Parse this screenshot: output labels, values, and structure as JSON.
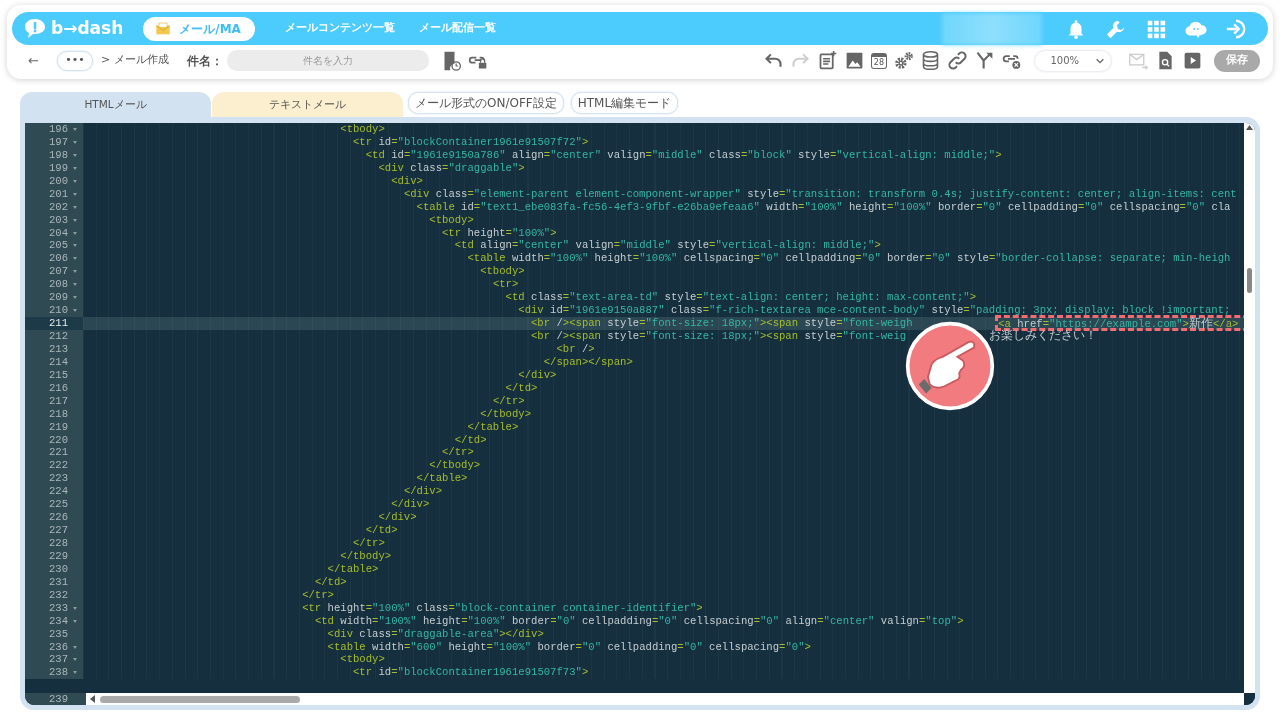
{
  "header": {
    "logo": "b→dash",
    "module": "メール/MA",
    "nav": [
      "メールコンテンツ一覧",
      "メール配信一覧"
    ],
    "icons": [
      {
        "kind": "bell"
      },
      {
        "kind": "wrench"
      },
      {
        "kind": "apps"
      },
      {
        "kind": "mascot"
      },
      {
        "kind": "signin"
      }
    ]
  },
  "toolbar": {
    "back": "←",
    "more": "•••",
    "breadcrumb": "> メール作成",
    "subject_label": "件名：",
    "subject": {
      "placeholder": "件名を入力"
    },
    "left_tools": [
      {
        "kind": "doc-clock",
        "disabled": false
      },
      {
        "kind": "link-lock",
        "disabled": false
      }
    ],
    "tools": [
      {
        "kind": "undo",
        "disabled": false
      },
      {
        "kind": "redo",
        "disabled": true
      },
      {
        "kind": "add-note",
        "disabled": false
      },
      {
        "kind": "image",
        "disabled": false
      },
      {
        "kind": "calendar",
        "text": "28",
        "disabled": false
      },
      {
        "kind": "gears",
        "disabled": false
      },
      {
        "kind": "database",
        "disabled": false
      },
      {
        "kind": "link",
        "disabled": false
      },
      {
        "kind": "merge",
        "disabled": false
      },
      {
        "kind": "unlink",
        "disabled": false
      }
    ],
    "zoom": "100%",
    "right_tools": [
      {
        "kind": "mail-send",
        "disabled": true
      },
      {
        "kind": "doc-search",
        "disabled": false
      },
      {
        "kind": "play",
        "disabled": false
      }
    ],
    "save": {
      "label": "保存",
      "disabled": true
    }
  },
  "tabs": [
    {
      "label": "HTMLメール",
      "selected": true
    },
    {
      "label": "テキストメール",
      "selected": false
    }
  ],
  "mode_buttons": [
    "メール形式のON/OFF設定",
    "HTML編集モード"
  ],
  "editor": {
    "lines": [
      {
        "number": "196",
        "foldable": true,
        "active": false,
        "segments": [
          "                                        <tbody>"
        ]
      },
      {
        "number": "197",
        "foldable": true,
        "active": false,
        "segments": [
          "                                          <tr id=\"blockContainer1961e91507f72\">"
        ]
      },
      {
        "number": "198",
        "foldable": true,
        "active": false,
        "segments": [
          "                                            <td id=\"1961e9150a786\" align=\"center\" valign=\"middle\" class=\"block\" style=\"vertical-align: middle;\">"
        ]
      },
      {
        "number": "199",
        "foldable": true,
        "active": false,
        "segments": [
          "                                              <div class=\"draggable\">"
        ]
      },
      {
        "number": "200",
        "foldable": true,
        "active": false,
        "segments": [
          "                                                <div>"
        ]
      },
      {
        "number": "201",
        "foldable": true,
        "active": false,
        "segments": [
          "                                                  <div class=\"element-parent element-component-wrapper\" style=\"transition: transform 0.4s; justify-content: center; align-items: cent"
        ]
      },
      {
        "number": "202",
        "foldable": true,
        "active": false,
        "segments": [
          "                                                    <table id=\"text1_ebe083fa-fc56-4ef3-9fbf-e26ba9efeaa6\" width=\"100%\" height=\"100%\" border=\"0\" cellpadding=\"0\" cellspacing=\"0\" cla"
        ]
      },
      {
        "number": "203",
        "foldable": true,
        "active": false,
        "segments": [
          "                                                      <tbody>"
        ]
      },
      {
        "number": "204",
        "foldable": true,
        "active": false,
        "segments": [
          "                                                        <tr height=\"100%\">"
        ]
      },
      {
        "number": "205",
        "foldable": true,
        "active": false,
        "segments": [
          "                                                          <td align=\"center\" valign=\"middle\" style=\"vertical-align: middle;\">"
        ]
      },
      {
        "number": "206",
        "foldable": true,
        "active": false,
        "segments": [
          "                                                            <table width=\"100%\" height=\"100%\" cellspacing=\"0\" cellpadding=\"0\" border=\"0\" style=\"border-collapse: separate; min-heigh"
        ]
      },
      {
        "number": "207",
        "foldable": true,
        "active": false,
        "segments": [
          "                                                              <tbody>"
        ]
      },
      {
        "number": "208",
        "foldable": true,
        "active": false,
        "segments": [
          "                                                                <tr>"
        ]
      },
      {
        "number": "209",
        "foldable": true,
        "active": false,
        "segments": [
          "                                                                  <td class=\"text-area-td\" style=\"text-align: center; height: max-content;\">"
        ]
      },
      {
        "number": "210",
        "foldable": true,
        "active": false,
        "segments": [
          "                                                                    <div id=\"1961e9150a887\" class=\"f-rich-textarea mce-content-body\" style=\"padding: 3px; display: block !important;"
        ]
      },
      {
        "number": "211",
        "foldable": false,
        "active": true,
        "callout": true,
        "segments": [
          "                                                                      <br /><span style=\"font-size: 18px;\"><span style=\"font-weigh",
          "<a href=\"https://example.com\">新作</a>"
        ]
      },
      {
        "number": "212",
        "foldable": false,
        "active": false,
        "segments": [
          "                                                                      <br /><span style=\"font-size: 18px;\"><span style=\"font-weig",
          "お楽しみください！"
        ]
      },
      {
        "number": "213",
        "foldable": false,
        "active": false,
        "segments": [
          "                                                                          <br />"
        ]
      },
      {
        "number": "214",
        "foldable": false,
        "active": false,
        "segments": [
          "                                                                        </span></span>"
        ]
      },
      {
        "number": "215",
        "foldable": false,
        "active": false,
        "segments": [
          "                                                                    </div>"
        ]
      },
      {
        "number": "216",
        "foldable": false,
        "active": false,
        "segments": [
          "                                                                  </td>"
        ]
      },
      {
        "number": "217",
        "foldable": false,
        "active": false,
        "segments": [
          "                                                                </tr>"
        ]
      },
      {
        "number": "218",
        "foldable": false,
        "active": false,
        "segments": [
          "                                                              </tbody>"
        ]
      },
      {
        "number": "219",
        "foldable": false,
        "active": false,
        "segments": [
          "                                                            </table>"
        ]
      },
      {
        "number": "220",
        "foldable": false,
        "active": false,
        "segments": [
          "                                                          </td>"
        ]
      },
      {
        "number": "221",
        "foldable": false,
        "active": false,
        "segments": [
          "                                                        </tr>"
        ]
      },
      {
        "number": "222",
        "foldable": false,
        "active": false,
        "segments": [
          "                                                      </tbody>"
        ]
      },
      {
        "number": "223",
        "foldable": false,
        "active": false,
        "segments": [
          "                                                    </table>"
        ]
      },
      {
        "number": "224",
        "foldable": false,
        "active": false,
        "segments": [
          "                                                  </div>"
        ]
      },
      {
        "number": "225",
        "foldable": false,
        "active": false,
        "segments": [
          "                                                </div>"
        ]
      },
      {
        "number": "226",
        "foldable": false,
        "active": false,
        "segments": [
          "                                              </div>"
        ]
      },
      {
        "number": "227",
        "foldable": false,
        "active": false,
        "segments": [
          "                                            </td>"
        ]
      },
      {
        "number": "228",
        "foldable": false,
        "active": false,
        "segments": [
          "                                          </tr>"
        ]
      },
      {
        "number": "229",
        "foldable": false,
        "active": false,
        "segments": [
          "                                        </tbody>"
        ]
      },
      {
        "number": "230",
        "foldable": false,
        "active": false,
        "segments": [
          "                                      </table>"
        ]
      },
      {
        "number": "231",
        "foldable": false,
        "active": false,
        "segments": [
          "                                    </td>"
        ]
      },
      {
        "number": "232",
        "foldable": false,
        "active": false,
        "segments": [
          "                                  </tr>"
        ]
      },
      {
        "number": "233",
        "foldable": true,
        "active": false,
        "segments": [
          "                                  <tr height=\"100%\" class=\"block-container container-identifier\">"
        ]
      },
      {
        "number": "234",
        "foldable": true,
        "active": false,
        "segments": [
          "                                    <td width=\"100%\" height=\"100%\" border=\"0\" cellpadding=\"0\" cellspacing=\"0\" align=\"center\" valign=\"top\">"
        ]
      },
      {
        "number": "235",
        "foldable": false,
        "active": false,
        "segments": [
          "                                      <div class=\"draggable-area\"></div>"
        ]
      },
      {
        "number": "236",
        "foldable": true,
        "active": false,
        "segments": [
          "                                      <table width=\"600\" height=\"100%\" border=\"0\" cellpadding=\"0\" cellspacing=\"0\">"
        ]
      },
      {
        "number": "237",
        "foldable": true,
        "active": false,
        "segments": [
          "                                        <tbody>"
        ]
      },
      {
        "number": "238",
        "foldable": true,
        "active": false,
        "segments": [
          "                                          <tr id=\"blockContainer1961e91507f73\">"
        ]
      },
      {
        "number": "239",
        "foldable": false,
        "active": false
      }
    ]
  }
}
